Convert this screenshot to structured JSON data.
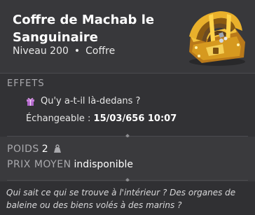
{
  "item": {
    "name": "Coffre de Machab le Sanguinaire",
    "level": "Niveau 200",
    "separator": "•",
    "type": "Coffre",
    "image_icon": "golden-chest-icon"
  },
  "effects": {
    "title": "EFFETS",
    "line": "Qu'y a-t-il là-dedans ?",
    "line_icon": "gift-icon",
    "exchange_label": "Échangeable :",
    "exchange_date": "15/03/656 10:07"
  },
  "stats": {
    "weight_label": "POIDS",
    "weight_value": "2",
    "weight_icon": "weight-icon",
    "price_label": "PRIX MOYEN",
    "price_value": "indisponible"
  },
  "description": "Qui sait ce qui se trouve à l'intérieur ? Des organes de baleine ou des biens volés à des marins ?",
  "colors": {
    "background": "#3a3a3d",
    "section_label": "#a9a9ad",
    "gift_icon": "#c77ddb",
    "chest_gold": "#e0a21e"
  }
}
